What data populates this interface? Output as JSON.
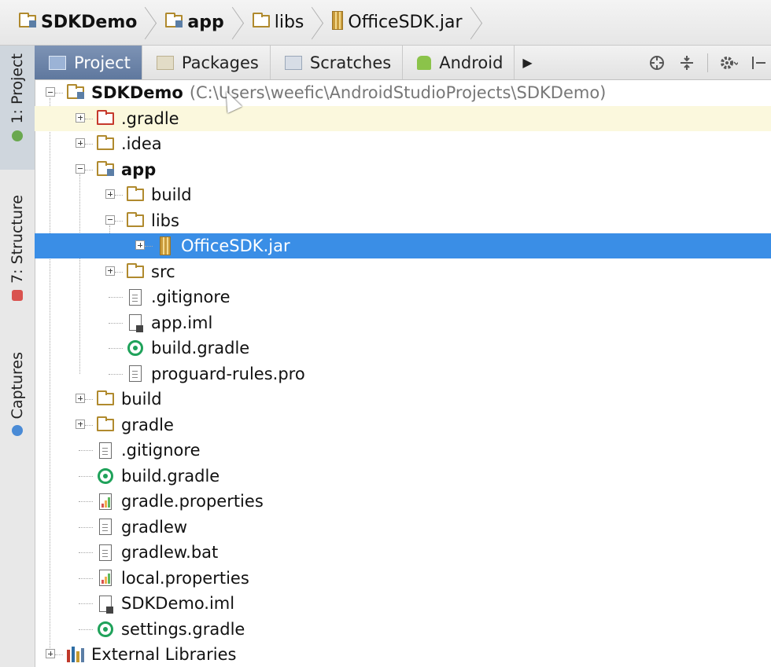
{
  "breadcrumb": {
    "items": [
      {
        "label": "SDKDemo",
        "icon": "module-folder-icon",
        "bold": true
      },
      {
        "label": "app",
        "icon": "module-folder-icon",
        "bold": true
      },
      {
        "label": "libs",
        "icon": "folder-icon",
        "bold": false
      },
      {
        "label": "OfficeSDK.jar",
        "icon": "jar-icon",
        "bold": false
      }
    ]
  },
  "side_tabs": {
    "project": "1: Project",
    "structure": "7: Structure",
    "captures": "Captures"
  },
  "tool_header": {
    "tabs": [
      {
        "label": "Project",
        "active": true
      },
      {
        "label": "Packages",
        "active": false
      },
      {
        "label": "Scratches",
        "active": false
      },
      {
        "label": "Android",
        "active": false
      }
    ],
    "more_glyph": "▶",
    "tools": [
      "crosshair-icon",
      "collapse-icon",
      "gear-icon",
      "hide-icon"
    ]
  },
  "tree": {
    "root": {
      "label": "SDKDemo",
      "path": "(C:\\Users\\weefic\\AndroidStudioProjects\\SDKDemo)"
    },
    "rows": [
      {
        "label": ".gradle",
        "icon": "folder-red",
        "level": 1,
        "expander": "plus"
      },
      {
        "label": ".idea",
        "icon": "folder",
        "level": 1,
        "expander": "plus"
      },
      {
        "label": "app",
        "icon": "folder-module",
        "level": 1,
        "expander": "minus",
        "bold": true
      },
      {
        "label": "build",
        "icon": "folder",
        "level": 2,
        "expander": "plus"
      },
      {
        "label": "libs",
        "icon": "folder",
        "level": 2,
        "expander": "minus"
      },
      {
        "label": "OfficeSDK.jar",
        "icon": "jar",
        "level": 3,
        "expander": "plus",
        "selected": true
      },
      {
        "label": "src",
        "icon": "folder",
        "level": 2,
        "expander": "plus"
      },
      {
        "label": ".gitignore",
        "icon": "file",
        "level": 2,
        "expander": "none"
      },
      {
        "label": "app.iml",
        "icon": "iml",
        "level": 2,
        "expander": "none"
      },
      {
        "label": "build.gradle",
        "icon": "gradle",
        "level": 2,
        "expander": "none"
      },
      {
        "label": "proguard-rules.pro",
        "icon": "file",
        "level": 2,
        "expander": "none"
      },
      {
        "label": "build",
        "icon": "folder",
        "level": 1,
        "expander": "plus"
      },
      {
        "label": "gradle",
        "icon": "folder",
        "level": 1,
        "expander": "plus"
      },
      {
        "label": ".gitignore",
        "icon": "file",
        "level": 1,
        "expander": "none"
      },
      {
        "label": "build.gradle",
        "icon": "gradle",
        "level": 1,
        "expander": "none"
      },
      {
        "label": "gradle.properties",
        "icon": "props",
        "level": 1,
        "expander": "none"
      },
      {
        "label": "gradlew",
        "icon": "file",
        "level": 1,
        "expander": "none"
      },
      {
        "label": "gradlew.bat",
        "icon": "file",
        "level": 1,
        "expander": "none"
      },
      {
        "label": "local.properties",
        "icon": "props",
        "level": 1,
        "expander": "none"
      },
      {
        "label": "SDKDemo.iml",
        "icon": "iml",
        "level": 1,
        "expander": "none"
      },
      {
        "label": "settings.gradle",
        "icon": "gradle",
        "level": 1,
        "expander": "none"
      }
    ],
    "external": {
      "label": "External Libraries",
      "icon": "libraries"
    }
  },
  "colors": {
    "selection": "#3a8ee6",
    "current_row": "#fbf8dd",
    "active_tab": "#6a83a9",
    "folder": "#b08a2e",
    "excluded_folder": "#c6392c",
    "gradle": "#1fa25a"
  }
}
